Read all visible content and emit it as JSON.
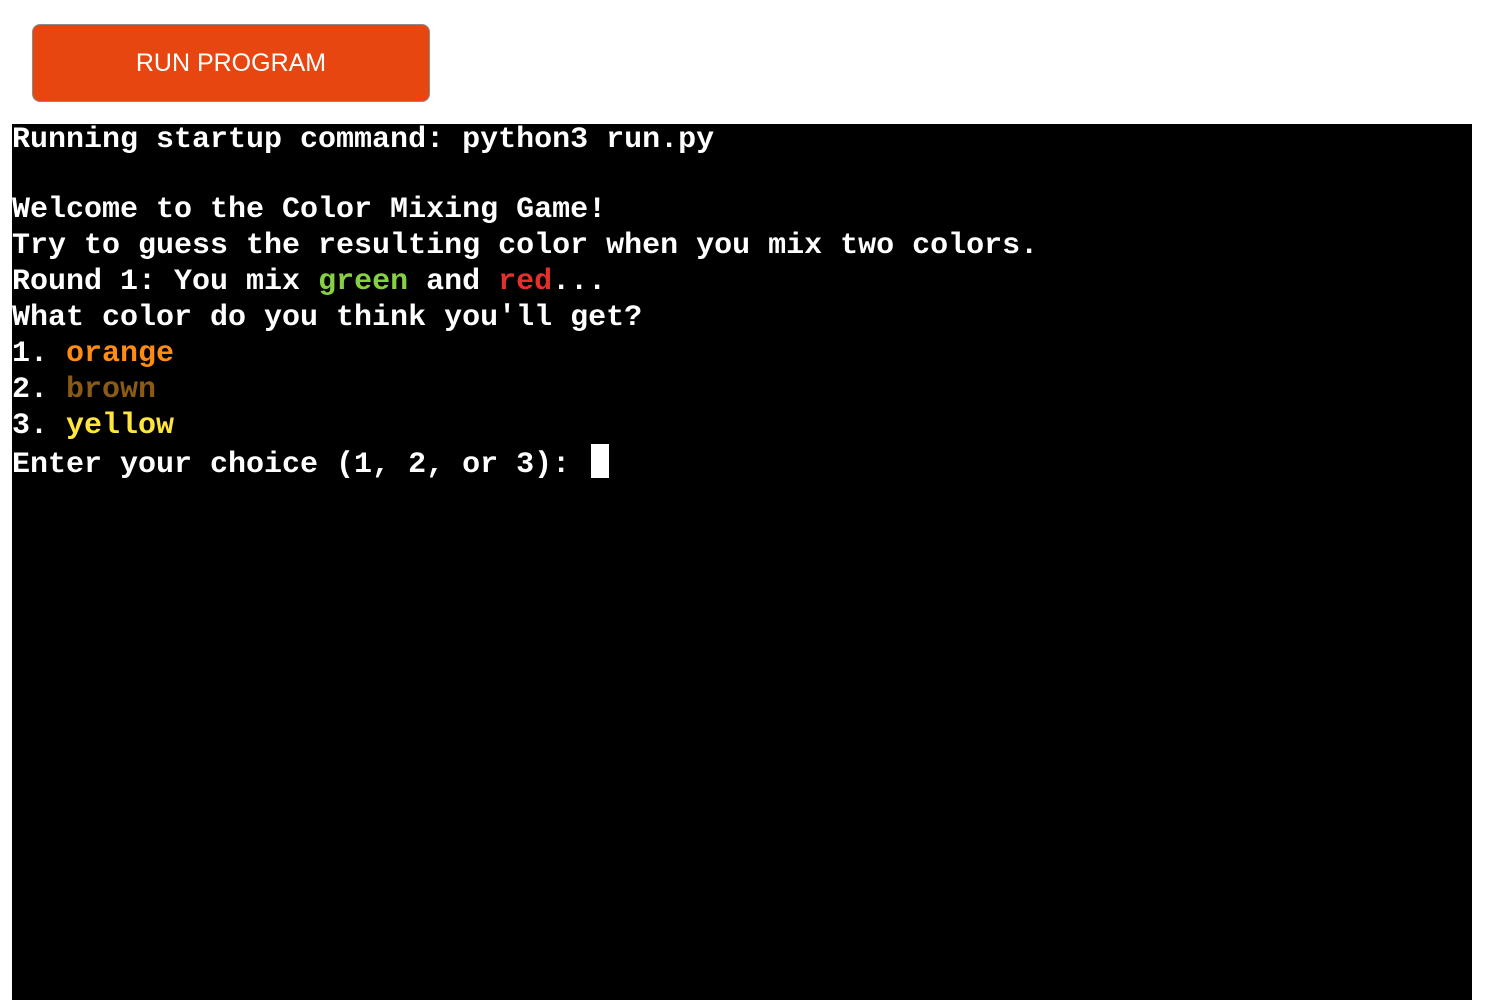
{
  "run_button": {
    "label": "RUN PROGRAM",
    "color": "#e84611"
  },
  "terminal": {
    "background": "#000000",
    "startup_line": "Running startup command: python3 run.py",
    "welcome_line": "Welcome to the Color Mixing Game!",
    "instructions_line": "Try to guess the resulting color when you mix two colors.",
    "round_line": {
      "prefix": "Round 1: You mix ",
      "color_a": "green",
      "color_a_hex": "#85d043",
      "joiner": " and ",
      "color_b": "red",
      "color_b_hex": "#e3302c",
      "suffix": "..."
    },
    "question_line": "What color do you think you'll get?",
    "options": [
      {
        "number": "1. ",
        "label": "orange",
        "color": "#ff8c12"
      },
      {
        "number": "2. ",
        "label": "brown",
        "color": "#8b5b13"
      },
      {
        "number": "3. ",
        "label": "yellow",
        "color": "#ffe63c"
      }
    ],
    "prompt_line": "Enter your choice (1, 2, or 3): ",
    "input_value": ""
  }
}
